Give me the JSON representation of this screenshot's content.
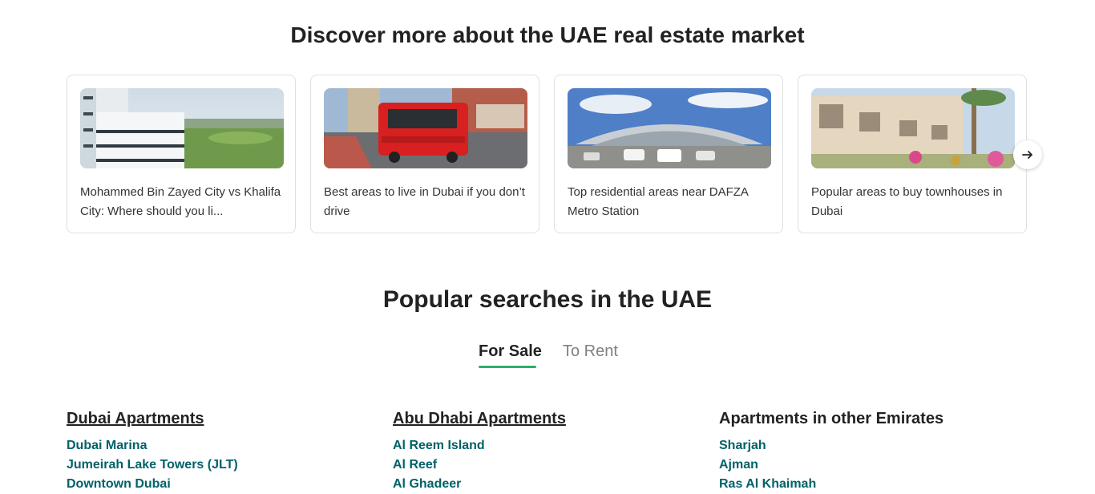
{
  "discover": {
    "heading": "Discover more about the UAE real estate market",
    "cards": [
      {
        "title": "Mohammed Bin Zayed City vs Khalifa City: Where should you li..."
      },
      {
        "title": "Best areas to live in Dubai if you don’t drive"
      },
      {
        "title": "Top residential areas near DAFZA Metro Station"
      },
      {
        "title": "Popular areas to buy townhouses in Dubai"
      }
    ],
    "next_icon": "arrow-right-icon"
  },
  "popular": {
    "heading": "Popular searches in the UAE",
    "tabs": [
      {
        "label": "For Sale",
        "active": true
      },
      {
        "label": "To Rent",
        "active": false
      }
    ],
    "accent_color": "#28b16d",
    "link_color": "#006169",
    "columns": [
      {
        "heading": "Dubai Apartments",
        "items": [
          "Dubai Marina",
          "Jumeirah Lake Towers (JLT)",
          "Downtown Dubai"
        ]
      },
      {
        "heading": "Abu Dhabi Apartments",
        "items": [
          "Al Reem Island",
          "Al Reef",
          "Al Ghadeer"
        ]
      },
      {
        "heading": "Apartments in other Emirates",
        "items": [
          "Sharjah",
          "Ajman",
          "Ras Al Khaimah"
        ]
      }
    ]
  }
}
